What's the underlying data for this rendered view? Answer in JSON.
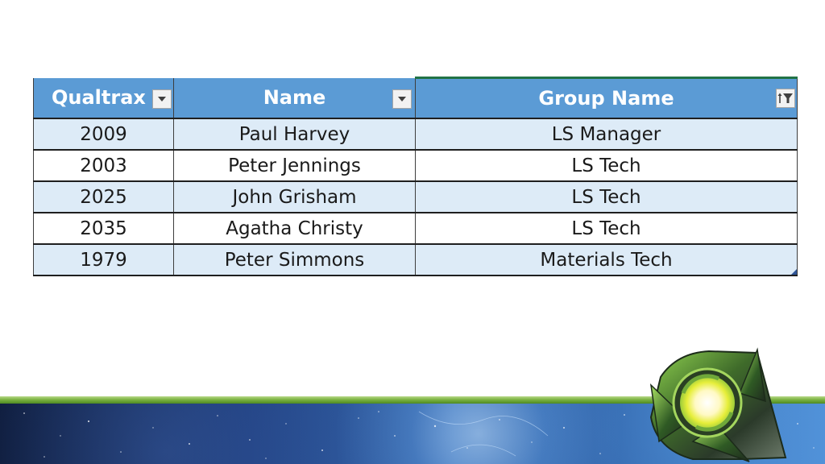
{
  "table": {
    "columns": [
      {
        "label": "Qualtrax ID",
        "shown": "Qualtrax I",
        "filter_state": "dropdown"
      },
      {
        "label": "Name",
        "shown": "Name",
        "filter_state": "dropdown"
      },
      {
        "label": "Group Name",
        "shown": "Group Name",
        "filter_state": "sorted-filtered"
      }
    ],
    "rows": [
      {
        "id": "2009",
        "name": "Paul Harvey",
        "group": "LS Manager"
      },
      {
        "id": "2003",
        "name": "Peter Jennings",
        "group": "LS Tech"
      },
      {
        "id": "2025",
        "name": "John Grisham",
        "group": "LS Tech"
      },
      {
        "id": "2035",
        "name": "Agatha Christy",
        "group": "LS Tech"
      },
      {
        "id": "1979",
        "name": "Peter Simmons",
        "group": "Materials Tech"
      }
    ]
  },
  "icons": {
    "filter_dropdown": "dropdown-arrow-icon",
    "filter_active": "sort-filter-icon",
    "brand_logo": "qualtrax-q-logo"
  },
  "colors": {
    "header_bg": "#5b9bd5",
    "header_text": "#ffffff",
    "band_row": "#ddebf7",
    "plain_row": "#ffffff",
    "active_column_accent": "#217346",
    "footer_stripe": "#7cb342"
  }
}
